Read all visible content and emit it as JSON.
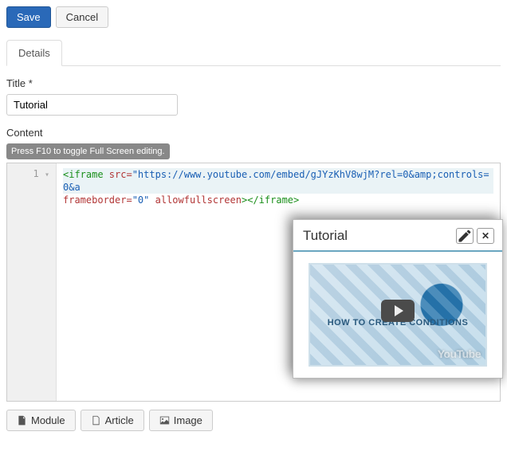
{
  "toolbar": {
    "save_label": "Save",
    "cancel_label": "Cancel"
  },
  "tabs": {
    "active": "Details"
  },
  "fields": {
    "title_label": "Title *",
    "title_value": "Tutorial",
    "content_label": "Content"
  },
  "editor": {
    "hint": "Press F10 to toggle Full Screen editing.",
    "line_number": "1",
    "code": {
      "tag_open": "<iframe",
      "attr_src": " src=",
      "val_src": "\"https://www.youtube.com/embed/gJYzKhV8wjM?rel=0&amp;controls=0&a",
      "attr_frameborder": "frameborder=",
      "val_frameborder": "\"0\"",
      "attr_allow": " allowfullscreen",
      "tag_mid": ">",
      "tag_close": "</iframe>"
    }
  },
  "popup": {
    "title": "Tutorial",
    "thumb_text": "HOW TO CREATE CONDITIONS",
    "brand": "YouTube"
  },
  "bottom": {
    "module_label": "Module",
    "article_label": "Article",
    "image_label": "Image"
  }
}
